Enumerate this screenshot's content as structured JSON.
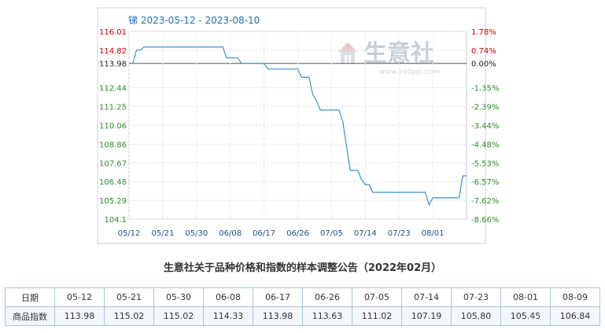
{
  "chart_data": {
    "type": "line",
    "title": "锑 2023-05-12 - 2023-08-10",
    "xlabel": "",
    "ylabel": "",
    "ylim": [
      104.1,
      116.01
    ],
    "base_value": 113.98,
    "left_ticks": [
      "116.01",
      "114.82",
      "113.98",
      "112.44",
      "111.25",
      "110.06",
      "108.86",
      "107.67",
      "106.48",
      "105.29",
      "104.1"
    ],
    "left_tick_values": [
      116.01,
      114.82,
      113.98,
      112.44,
      111.25,
      110.06,
      108.86,
      107.67,
      106.48,
      105.29,
      104.1
    ],
    "right_ticks": [
      "1.78%",
      "0.74%",
      "0.00%",
      "-1.35%",
      "-2.39%",
      "-3.44%",
      "-4.48%",
      "-5.53%",
      "-6.57%",
      "-7.62%",
      "-8.66%"
    ],
    "x_ticks": [
      "05/12",
      "05/21",
      "05/30",
      "06/08",
      "06/17",
      "06/26",
      "07/05",
      "07/14",
      "07/23",
      "08/01"
    ],
    "x_range": [
      "2023-05-12",
      "2023-08-10"
    ],
    "grid": true,
    "series": [
      {
        "color": "#3a8fd0",
        "points": [
          [
            "2023-05-12",
            113.98
          ],
          [
            "2023-05-13",
            113.98
          ],
          [
            "2023-05-14",
            114.82
          ],
          [
            "2023-05-15",
            114.82
          ],
          [
            "2023-05-16",
            115.02
          ],
          [
            "2023-05-21",
            115.02
          ],
          [
            "2023-05-30",
            115.02
          ],
          [
            "2023-06-06",
            115.02
          ],
          [
            "2023-06-07",
            114.33
          ],
          [
            "2023-06-08",
            114.33
          ],
          [
            "2023-06-10",
            114.33
          ],
          [
            "2023-06-11",
            113.98
          ],
          [
            "2023-06-17",
            113.98
          ],
          [
            "2023-06-18",
            113.63
          ],
          [
            "2023-06-26",
            113.63
          ],
          [
            "2023-06-27",
            113.1
          ],
          [
            "2023-06-29",
            113.1
          ],
          [
            "2023-06-30",
            112.0
          ],
          [
            "2023-07-01",
            111.6
          ],
          [
            "2023-07-02",
            111.02
          ],
          [
            "2023-07-05",
            111.02
          ],
          [
            "2023-07-07",
            111.02
          ],
          [
            "2023-07-08",
            110.3
          ],
          [
            "2023-07-10",
            107.19
          ],
          [
            "2023-07-12",
            107.19
          ],
          [
            "2023-07-13",
            106.6
          ],
          [
            "2023-07-14",
            106.3
          ],
          [
            "2023-07-15",
            106.3
          ],
          [
            "2023-07-16",
            105.8
          ],
          [
            "2023-07-23",
            105.8
          ],
          [
            "2023-07-30",
            105.8
          ],
          [
            "2023-07-31",
            105.0
          ],
          [
            "2023-08-01",
            105.45
          ],
          [
            "2023-08-02",
            105.45
          ],
          [
            "2023-08-08",
            105.45
          ],
          [
            "2023-08-09",
            106.84
          ],
          [
            "2023-08-10",
            106.84
          ]
        ]
      }
    ]
  },
  "watermark": {
    "brand": "生意社",
    "url": "www.100ppi.com"
  },
  "notice": "生意社关于品种价格和指数的样本调整公告（2022年02月）",
  "table": {
    "date_label": "日期",
    "index_label": "商品指数",
    "dates": [
      "05-12",
      "05-21",
      "05-30",
      "06-08",
      "06-17",
      "06-26",
      "07-05",
      "07-14",
      "07-23",
      "08-01",
      "08-09"
    ],
    "values": [
      "113.98",
      "115.02",
      "115.02",
      "114.33",
      "113.98",
      "113.63",
      "111.02",
      "107.19",
      "105.80",
      "105.45",
      "106.84"
    ]
  }
}
